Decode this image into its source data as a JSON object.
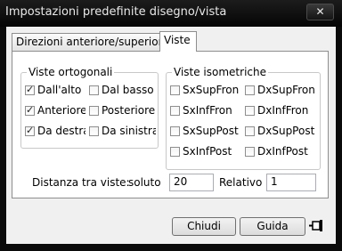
{
  "window": {
    "title": "Impostazioni predefinite disegno/vista",
    "close_glyph": "✕"
  },
  "tabs": [
    {
      "label": "Direzioni anteriore/superiore",
      "active": false
    },
    {
      "label": "Viste",
      "active": true
    }
  ],
  "ortho": {
    "title": "Viste ortogonali",
    "items": [
      {
        "label": "Dall'alto",
        "checked": true
      },
      {
        "label": "Dal basso",
        "checked": false
      },
      {
        "label": "Anteriore",
        "checked": true
      },
      {
        "label": "Posteriore",
        "checked": false
      },
      {
        "label": "Da destra",
        "checked": true
      },
      {
        "label": "Da sinistra",
        "checked": false
      }
    ]
  },
  "iso": {
    "title": "Viste isometriche",
    "items": [
      {
        "label": "SxSupFron",
        "checked": false
      },
      {
        "label": "DxSupFron",
        "checked": false
      },
      {
        "label": "SxInfFron",
        "checked": false
      },
      {
        "label": "DxInfFron",
        "checked": false
      },
      {
        "label": "SxSupPost",
        "checked": false
      },
      {
        "label": "DxSupPost",
        "checked": false
      },
      {
        "label": "SxInfPost",
        "checked": false
      },
      {
        "label": "DxInfPost",
        "checked": false
      }
    ]
  },
  "distance": {
    "label": "Distanza tra viste:",
    "absolute_label": "soluto",
    "absolute_value": "20",
    "relative_label": "Relativo",
    "relative_value": "1"
  },
  "buttons": {
    "close": "Chiudi",
    "help": "Guida",
    "pin_icon": "pin-icon"
  },
  "check_glyph": "✓"
}
